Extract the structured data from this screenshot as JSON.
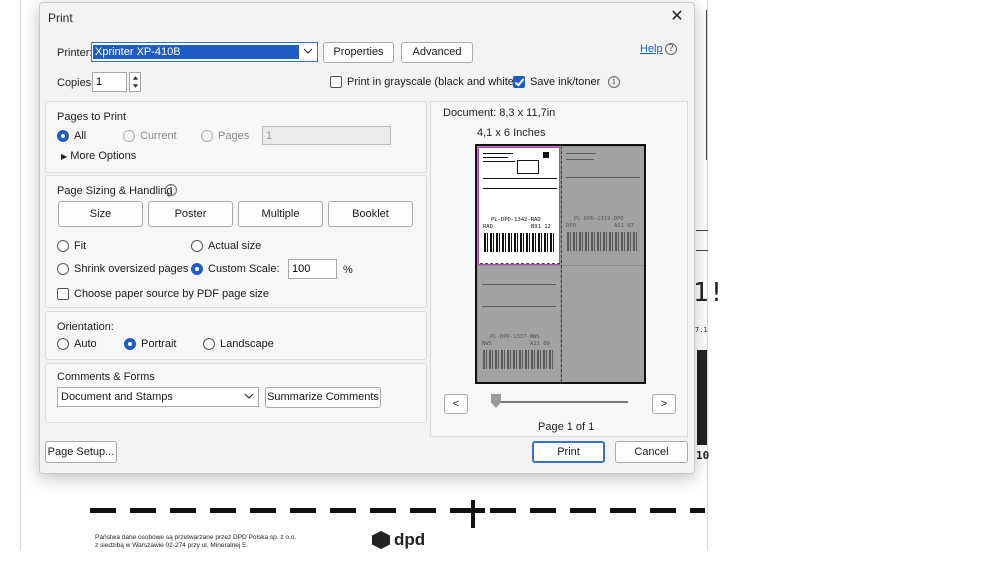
{
  "background": {
    "footer_line1": "Państwa dane osobowe są przetwarzane przez DPD Polska sp. z o.o.",
    "footer_line2": "z siedzibą w Warszawie 02-274 przy ul. Mineralnej 5.",
    "logo_text": "dpd",
    "right_fragment_1": "1!",
    "right_fragment_2": "7.1",
    "right_fragment_3": "10"
  },
  "dialog": {
    "title": "Print",
    "help_label": "Help",
    "printer_label": "Printer:",
    "printer_value": "Xprinter XP-410B",
    "properties_label": "Properties",
    "advanced_label": "Advanced",
    "copies_label": "Copies:",
    "copies_value": "1",
    "grayscale_label": "Print in grayscale (black and white)",
    "grayscale_checked": false,
    "save_ink_label": "Save ink/toner",
    "save_ink_checked": true
  },
  "pages_to_print": {
    "title": "Pages to Print",
    "all_label": "All",
    "current_label": "Current",
    "pages_label": "Pages",
    "pages_value": "1",
    "selected": "all",
    "more_options_label": "More Options"
  },
  "sizing": {
    "title": "Page Sizing & Handling",
    "size_label": "Size",
    "poster_label": "Poster",
    "multiple_label": "Multiple",
    "booklet_label": "Booklet",
    "fit_label": "Fit",
    "actual_size_label": "Actual size",
    "shrink_label": "Shrink oversized pages",
    "custom_scale_label": "Custom Scale:",
    "custom_scale_value": "100",
    "percent_label": "%",
    "selected": "custom_scale",
    "paper_source_label": "Choose paper source by PDF page size",
    "paper_source_checked": false
  },
  "orientation": {
    "title": "Orientation:",
    "auto_label": "Auto",
    "portrait_label": "Portrait",
    "landscape_label": "Landscape",
    "selected": "portrait"
  },
  "comments": {
    "title": "Comments & Forms",
    "select_value": "Document and Stamps",
    "summarize_label": "Summarize Comments"
  },
  "preview": {
    "document_info": "Document: 8,3 x 11,7in",
    "paper_size": "4,1 x 6 Inches",
    "page_indicator": "Page 1 of 1",
    "prev_label": "<",
    "next_label": ">",
    "label_text_1": "PL-DPD-1342-RAD",
    "label_text_2": "RAD",
    "label_text_3": "B91 12",
    "label_text_4": "PL-DPD-1319-DPD",
    "label_text_5": "DPO",
    "label_text_6": "A11 07",
    "label_text_7": "PL-DPD-1337-NWS",
    "label_text_8": "NWS",
    "label_text_9": "A11 09"
  },
  "footer": {
    "page_setup_label": "Page Setup...",
    "print_label": "Print",
    "cancel_label": "Cancel"
  },
  "colors": {
    "accent": "#1f5cc7",
    "preview_highlight": "#c33bc3"
  }
}
